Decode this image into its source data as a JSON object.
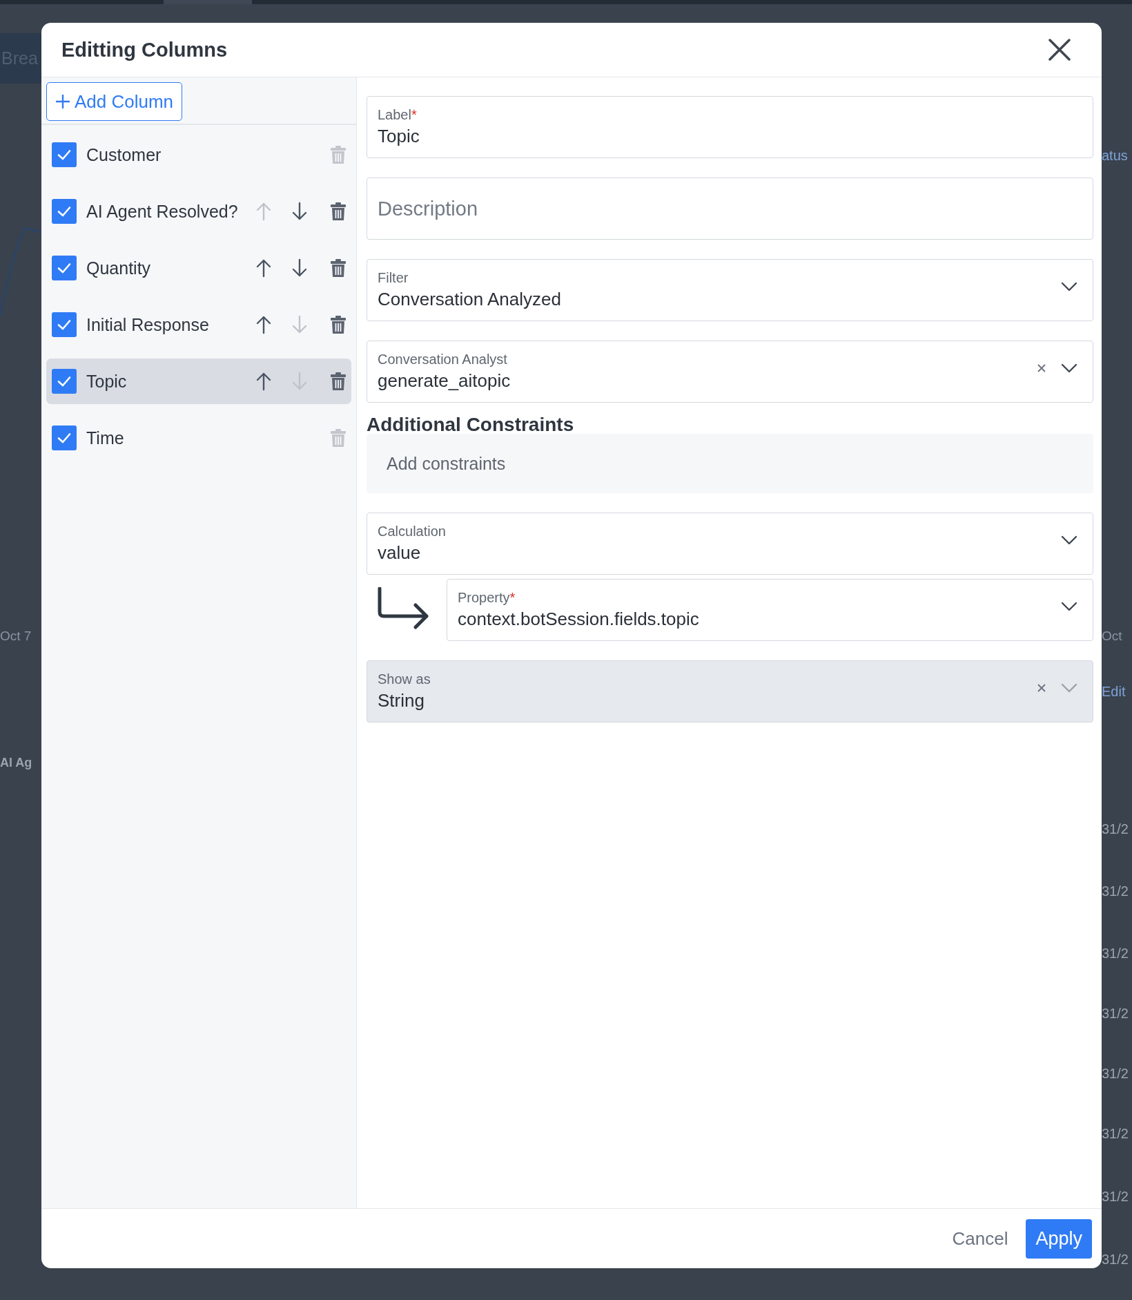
{
  "background": {
    "left_texts": [
      {
        "kind": "tab",
        "text": "Brea"
      },
      {
        "kind": "axis",
        "text": "Oct 7"
      },
      {
        "kind": "header",
        "text": "AI Ag"
      }
    ],
    "right_texts": [
      {
        "kind": "header",
        "text": "atus"
      },
      {
        "kind": "axis",
        "text": "Oct"
      },
      {
        "kind": "link",
        "text": "Edit"
      },
      {
        "kind": "cell",
        "text": "31/2"
      },
      {
        "kind": "cell",
        "text": "31/2"
      },
      {
        "kind": "cell",
        "text": "31/2"
      },
      {
        "kind": "cell",
        "text": "31/2"
      },
      {
        "kind": "cell",
        "text": "31/2"
      },
      {
        "kind": "cell",
        "text": "31/2"
      },
      {
        "kind": "cell",
        "text": "31/2"
      },
      {
        "kind": "cell",
        "text": "31/2"
      }
    ]
  },
  "dialog": {
    "title": "Editting Columns",
    "add_button": "Add Column",
    "columns": [
      {
        "label": "Customer",
        "checked": true,
        "selected": false,
        "delete_disabled": true
      },
      {
        "label": "AI Agent Resolved?",
        "checked": true,
        "selected": false,
        "move_up": {
          "disabled": true
        },
        "move_down": {
          "disabled": false
        },
        "delete_disabled": false
      },
      {
        "label": "Quantity",
        "checked": true,
        "selected": false,
        "move_up": {
          "disabled": false
        },
        "move_down": {
          "disabled": false
        },
        "delete_disabled": false
      },
      {
        "label": "Initial Response",
        "checked": true,
        "selected": false,
        "move_up": {
          "disabled": false
        },
        "move_down": {
          "disabled": true
        },
        "delete_disabled": false
      },
      {
        "label": "Topic",
        "checked": true,
        "selected": true,
        "move_up": {
          "disabled": false
        },
        "move_down": {
          "disabled": true
        },
        "delete_disabled": false
      },
      {
        "label": "Time",
        "checked": true,
        "selected": false,
        "delete_disabled": true
      }
    ],
    "fields": [
      {
        "kind": "text",
        "label": "Label",
        "required_mark": "*",
        "value": "Topic"
      },
      {
        "kind": "text",
        "placeholder": "Description"
      },
      {
        "kind": "select",
        "label": "Filter",
        "value": "Conversation Analyzed",
        "clearable": false,
        "disabled": false
      },
      {
        "kind": "select",
        "label": "Conversation Analyst",
        "value": "generate_aitopic",
        "clearable": true,
        "disabled": false
      },
      {
        "kind": "constraints",
        "title": "Additional Constraints",
        "placeholder": "Add constraints"
      },
      {
        "kind": "select",
        "label": "Calculation",
        "value": "value",
        "clearable": false,
        "disabled": false
      },
      {
        "kind": "nested",
        "label": "Property",
        "required_mark": "*",
        "value": "context.botSession.fields.topic",
        "clearable": false,
        "disabled": false
      },
      {
        "kind": "select",
        "label": "Show as",
        "value": "String",
        "clearable": true,
        "disabled": true
      }
    ],
    "buttons": {
      "cancel": "Cancel",
      "apply": "Apply"
    }
  }
}
